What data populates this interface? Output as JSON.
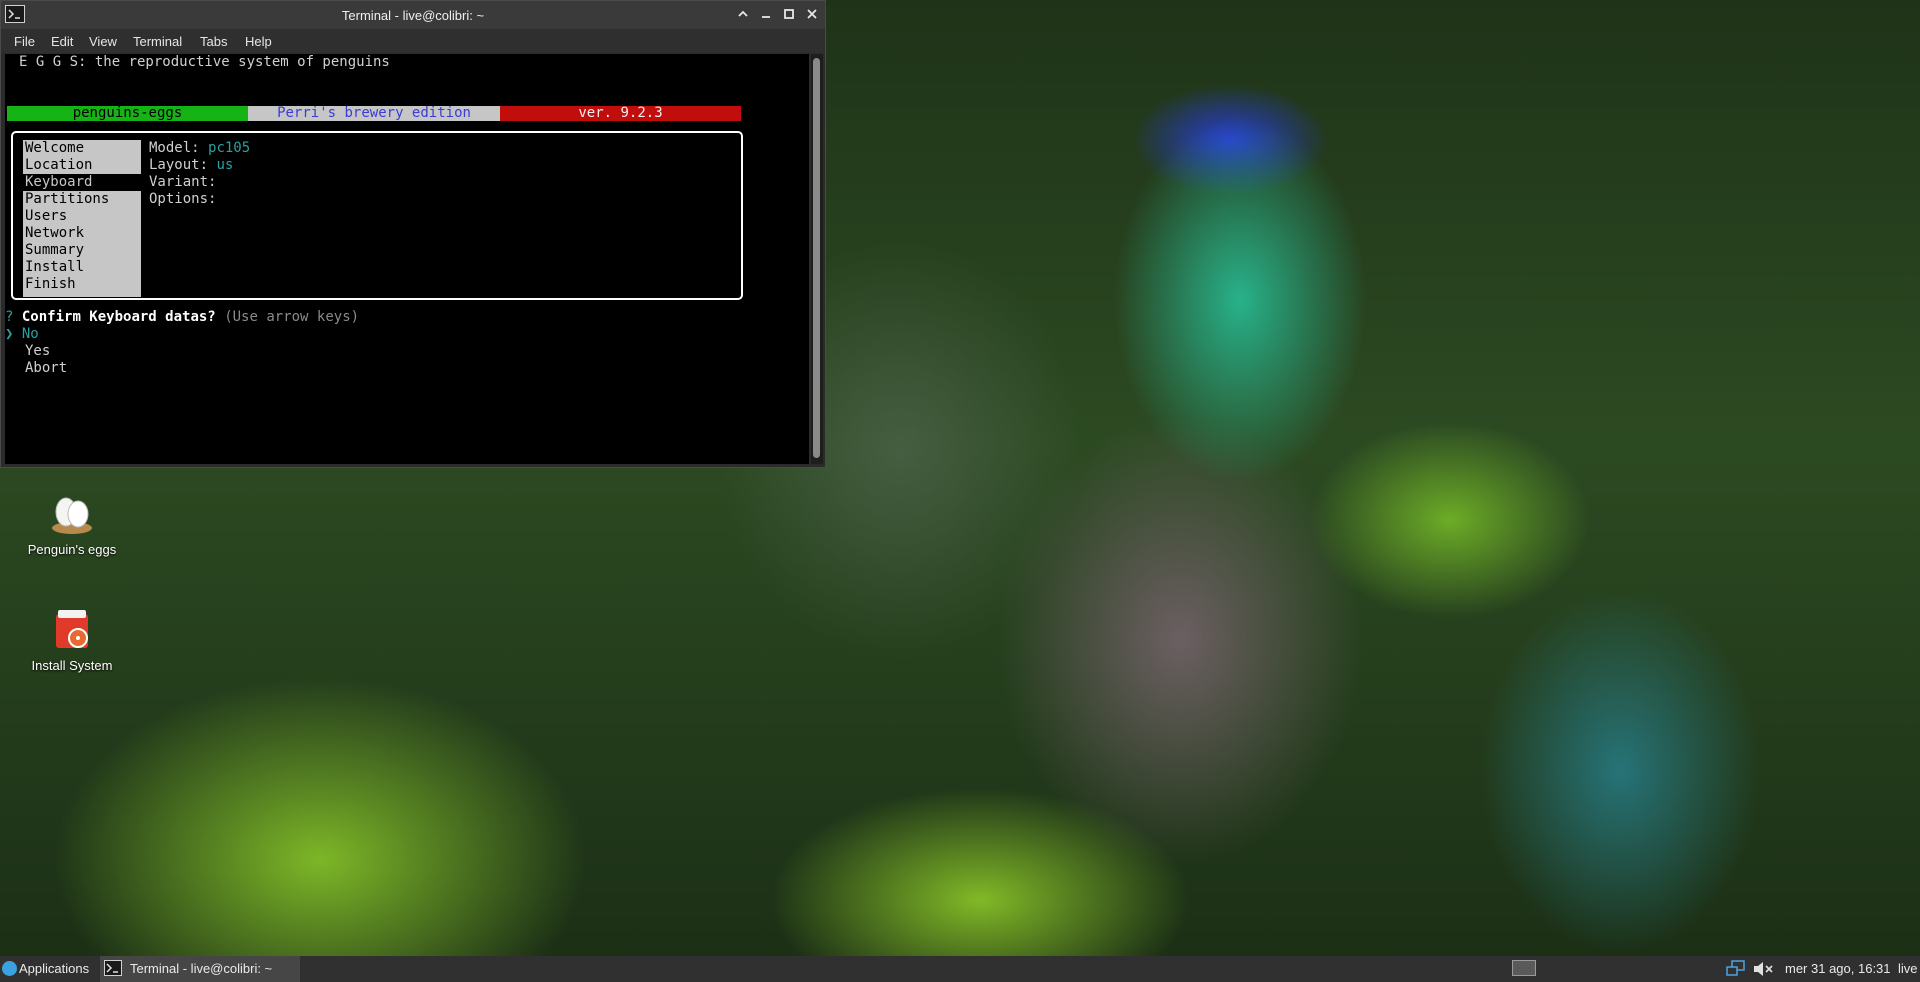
{
  "window": {
    "title": "Terminal - live@colibri: ~"
  },
  "menubar": {
    "items": [
      "File",
      "Edit",
      "View",
      "Terminal",
      "Tabs",
      "Help"
    ]
  },
  "terminal": {
    "header_line": "E G G S: the reproductive system of penguins",
    "banner": {
      "left": "penguins-eggs",
      "middle": "Perri's brewery edition",
      "right": "ver. 9.2.3",
      "colors": {
        "left": "#16b316",
        "middle": "#c6c6c6",
        "right": "#c20d0d"
      }
    },
    "steps": [
      "Welcome",
      "Location",
      "Keyboard",
      "Partitions",
      "Users",
      "Network",
      "Summary",
      "Install",
      "Finish"
    ],
    "active_step": "Keyboard",
    "fields": {
      "model_label": "Model:",
      "model_value": "pc105",
      "layout_label": "Layout:",
      "layout_value": "us",
      "variant_label": "Variant:",
      "options_label": "Options:"
    },
    "prompt": {
      "marker": "?",
      "question": "Confirm Keyboard datas?",
      "hint": "(Use arrow keys)",
      "pointer": "❯",
      "options": [
        "No",
        "Yes",
        "Abort"
      ],
      "selected": "No"
    }
  },
  "desktop_icons": [
    {
      "label": "Penguin's eggs",
      "icon": "eggs-icon"
    },
    {
      "label": "Install System",
      "icon": "installer-icon"
    }
  ],
  "taskbar": {
    "applications_label": "Applications",
    "task_label": "Terminal - live@colibri: ~",
    "clock": "mer 31 ago, 16:31",
    "user": "live"
  }
}
